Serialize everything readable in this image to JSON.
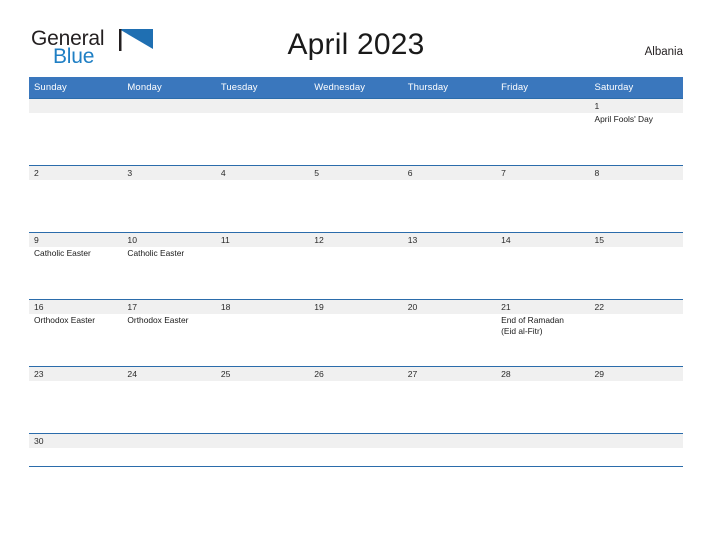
{
  "brand": {
    "name_part1": "General",
    "name_part2": "Blue",
    "flag_icon": "triangle-flag-icon",
    "accent_color": "#1f7fc4"
  },
  "header": {
    "title": "April 2023",
    "country": "Albania"
  },
  "theme": {
    "header_blue": "#3a77bd",
    "rule_blue": "#2b6cab",
    "date_band_gray": "#f0f0f0"
  },
  "calendar": {
    "weekday_headers": [
      "Sunday",
      "Monday",
      "Tuesday",
      "Wednesday",
      "Thursday",
      "Friday",
      "Saturday"
    ],
    "weeks": [
      [
        {
          "date": "",
          "events": []
        },
        {
          "date": "",
          "events": []
        },
        {
          "date": "",
          "events": []
        },
        {
          "date": "",
          "events": []
        },
        {
          "date": "",
          "events": []
        },
        {
          "date": "",
          "events": []
        },
        {
          "date": "1",
          "events": [
            "April Fools' Day"
          ]
        }
      ],
      [
        {
          "date": "2",
          "events": []
        },
        {
          "date": "3",
          "events": []
        },
        {
          "date": "4",
          "events": []
        },
        {
          "date": "5",
          "events": []
        },
        {
          "date": "6",
          "events": []
        },
        {
          "date": "7",
          "events": []
        },
        {
          "date": "8",
          "events": []
        }
      ],
      [
        {
          "date": "9",
          "events": [
            "Catholic Easter"
          ]
        },
        {
          "date": "10",
          "events": [
            "Catholic Easter"
          ]
        },
        {
          "date": "11",
          "events": []
        },
        {
          "date": "12",
          "events": []
        },
        {
          "date": "13",
          "events": []
        },
        {
          "date": "14",
          "events": []
        },
        {
          "date": "15",
          "events": []
        }
      ],
      [
        {
          "date": "16",
          "events": [
            "Orthodox Easter"
          ]
        },
        {
          "date": "17",
          "events": [
            "Orthodox Easter"
          ]
        },
        {
          "date": "18",
          "events": []
        },
        {
          "date": "19",
          "events": []
        },
        {
          "date": "20",
          "events": []
        },
        {
          "date": "21",
          "events": [
            "End of Ramadan",
            "(Eid al-Fitr)"
          ]
        },
        {
          "date": "22",
          "events": []
        }
      ],
      [
        {
          "date": "23",
          "events": []
        },
        {
          "date": "24",
          "events": []
        },
        {
          "date": "25",
          "events": []
        },
        {
          "date": "26",
          "events": []
        },
        {
          "date": "27",
          "events": []
        },
        {
          "date": "28",
          "events": []
        },
        {
          "date": "29",
          "events": []
        }
      ],
      [
        {
          "date": "30",
          "events": []
        },
        {
          "date": "",
          "events": []
        },
        {
          "date": "",
          "events": []
        },
        {
          "date": "",
          "events": []
        },
        {
          "date": "",
          "events": []
        },
        {
          "date": "",
          "events": []
        },
        {
          "date": "",
          "events": []
        }
      ]
    ]
  }
}
